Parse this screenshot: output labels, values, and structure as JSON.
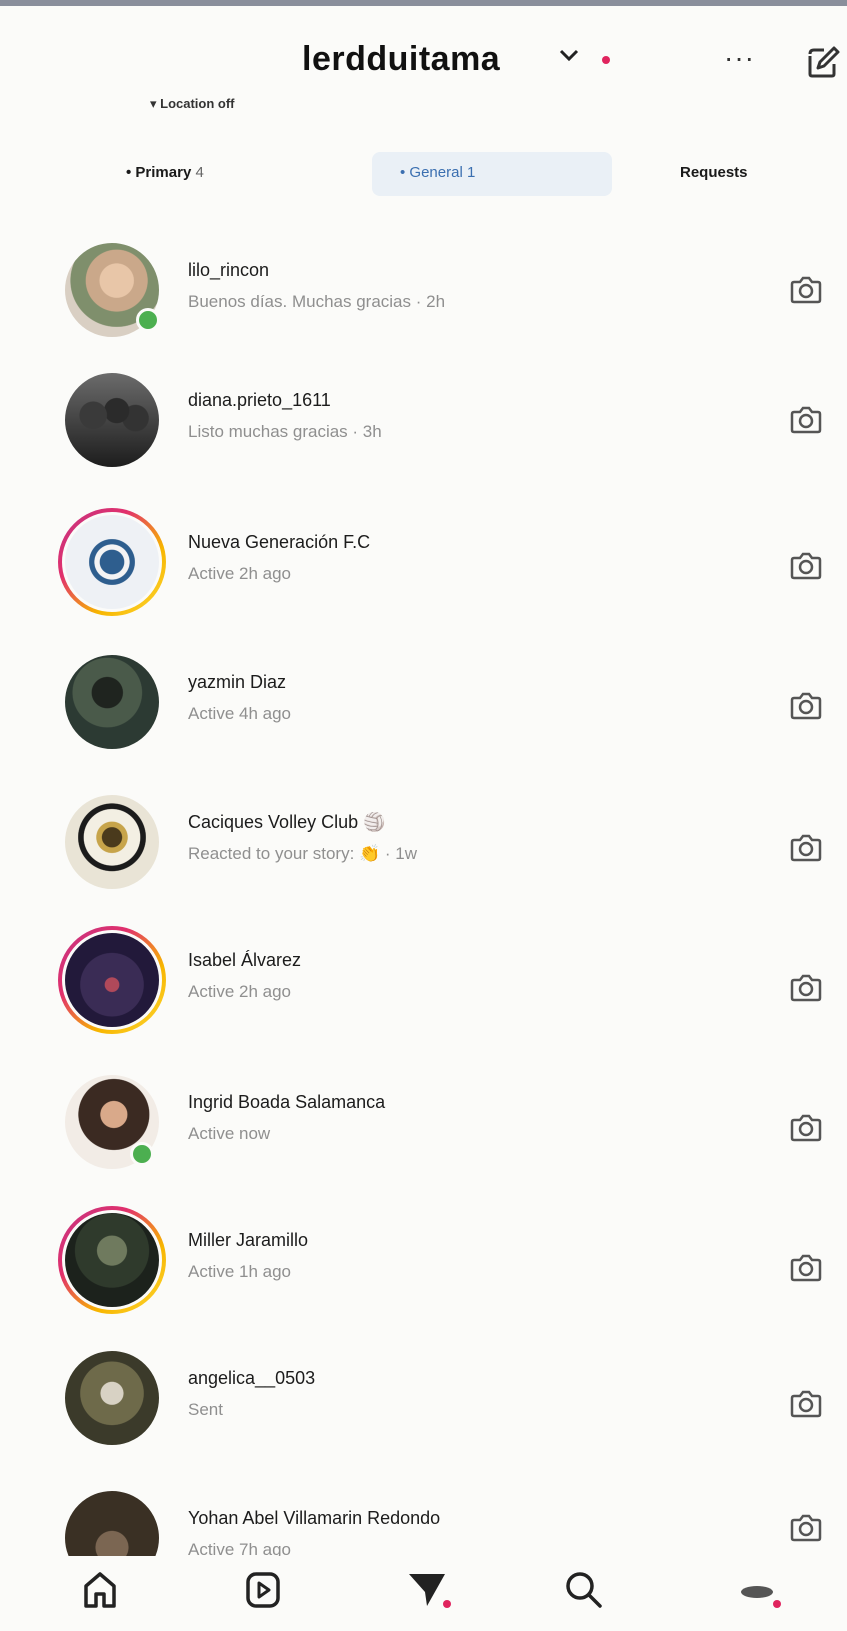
{
  "header": {
    "username": "lerdduitama",
    "location_status": "Location off",
    "more_label": "···"
  },
  "tabs": [
    {
      "label": "Primary",
      "count": "4",
      "selected": false
    },
    {
      "label": "General",
      "count": "1",
      "selected": true
    },
    {
      "label": "Requests",
      "count": "",
      "selected": false
    }
  ],
  "chats": [
    {
      "name": "lilo_rincon",
      "subtitle": "Buenos días. Muchas gracias · 2h",
      "online": true,
      "story_ring": false,
      "avatar": "photo"
    },
    {
      "name": "diana.prieto_1611",
      "subtitle": "Listo muchas gracias · 3h",
      "online": false,
      "story_ring": false,
      "avatar": "photo"
    },
    {
      "name": "Nueva Generación F.C",
      "subtitle": "Active 2h ago",
      "online": false,
      "story_ring": true,
      "avatar": "club-logo"
    },
    {
      "name": "yazmin Diaz",
      "subtitle": "Active 4h ago",
      "online": false,
      "story_ring": false,
      "avatar": "photo"
    },
    {
      "name": "Caciques Volley Club 🏐",
      "subtitle": "Reacted to your story: 👏 · 1w",
      "online": false,
      "story_ring": false,
      "avatar": "club-logo"
    },
    {
      "name": "Isabel Álvarez",
      "subtitle": "Active 2h ago",
      "online": false,
      "story_ring": true,
      "avatar": "photo"
    },
    {
      "name": "Ingrid Boada Salamanca",
      "subtitle": "Active now",
      "online": true,
      "story_ring": false,
      "avatar": "photo"
    },
    {
      "name": "Miller Jaramillo",
      "subtitle": "Active 1h ago",
      "online": false,
      "story_ring": true,
      "avatar": "photo"
    },
    {
      "name": "angelica__0503",
      "subtitle": "Sent",
      "online": false,
      "story_ring": false,
      "avatar": "photo"
    },
    {
      "name": "Yohan Abel Villamarin Redondo",
      "subtitle": "Active 7h ago",
      "online": false,
      "story_ring": false,
      "avatar": "photo"
    }
  ],
  "nav": [
    "home-icon",
    "reels-icon",
    "messages-icon",
    "search-icon",
    "profile-icon"
  ],
  "colors": {
    "accent_blue": "#3b6fb0",
    "online_green": "#4caf50",
    "notification_red": "#e0245e",
    "muted_text": "#8f8f8f"
  }
}
